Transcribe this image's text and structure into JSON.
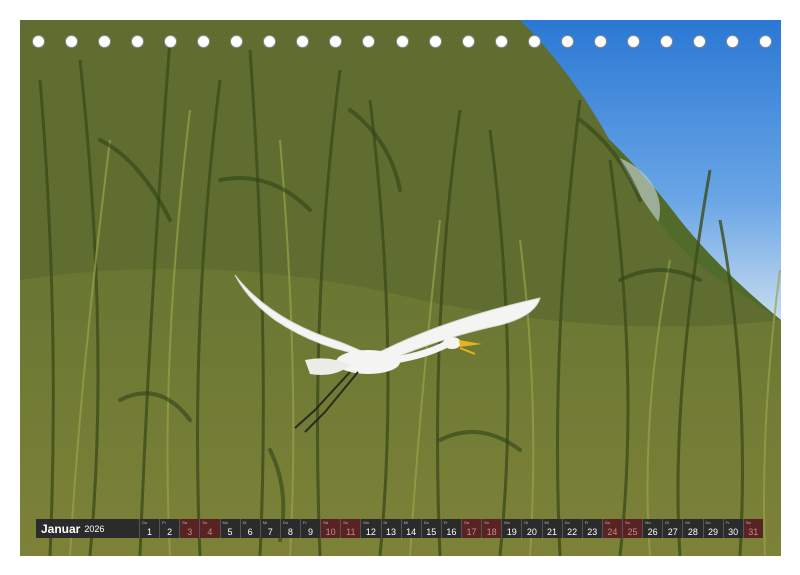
{
  "calendar": {
    "month": "Januar",
    "year": "2026",
    "days": [
      {
        "num": "1",
        "wd": "Do",
        "weekend": false
      },
      {
        "num": "2",
        "wd": "Fr",
        "weekend": false
      },
      {
        "num": "3",
        "wd": "Sa",
        "weekend": true
      },
      {
        "num": "4",
        "wd": "So",
        "weekend": true
      },
      {
        "num": "5",
        "wd": "Mo",
        "weekend": false
      },
      {
        "num": "6",
        "wd": "Di",
        "weekend": false
      },
      {
        "num": "7",
        "wd": "Mi",
        "weekend": false
      },
      {
        "num": "8",
        "wd": "Do",
        "weekend": false
      },
      {
        "num": "9",
        "wd": "Fr",
        "weekend": false
      },
      {
        "num": "10",
        "wd": "Sa",
        "weekend": true
      },
      {
        "num": "11",
        "wd": "So",
        "weekend": true
      },
      {
        "num": "12",
        "wd": "Mo",
        "weekend": false
      },
      {
        "num": "13",
        "wd": "Di",
        "weekend": false
      },
      {
        "num": "14",
        "wd": "Mi",
        "weekend": false
      },
      {
        "num": "15",
        "wd": "Do",
        "weekend": false
      },
      {
        "num": "16",
        "wd": "Fr",
        "weekend": false
      },
      {
        "num": "17",
        "wd": "Sa",
        "weekend": true
      },
      {
        "num": "18",
        "wd": "So",
        "weekend": true
      },
      {
        "num": "19",
        "wd": "Mo",
        "weekend": false
      },
      {
        "num": "20",
        "wd": "Di",
        "weekend": false
      },
      {
        "num": "21",
        "wd": "Mi",
        "weekend": false
      },
      {
        "num": "22",
        "wd": "Do",
        "weekend": false
      },
      {
        "num": "23",
        "wd": "Fr",
        "weekend": false
      },
      {
        "num": "24",
        "wd": "Sa",
        "weekend": true
      },
      {
        "num": "25",
        "wd": "So",
        "weekend": true
      },
      {
        "num": "26",
        "wd": "Mo",
        "weekend": false
      },
      {
        "num": "27",
        "wd": "Di",
        "weekend": false
      },
      {
        "num": "28",
        "wd": "Mi",
        "weekend": false
      },
      {
        "num": "29",
        "wd": "Do",
        "weekend": false
      },
      {
        "num": "30",
        "wd": "Fr",
        "weekend": false
      },
      {
        "num": "31",
        "wd": "Sa",
        "weekend": true
      }
    ]
  },
  "colors": {
    "strip_background": "#2b2b2b",
    "weekend_cell": "#5a2323",
    "sky": "#2f7fd6",
    "reeds": "#5e7032",
    "egret": "#f4f4f2",
    "beak": "#e8b21e"
  },
  "photo": {
    "subject": "egret-in-flight",
    "binding_hole_count": 23
  }
}
